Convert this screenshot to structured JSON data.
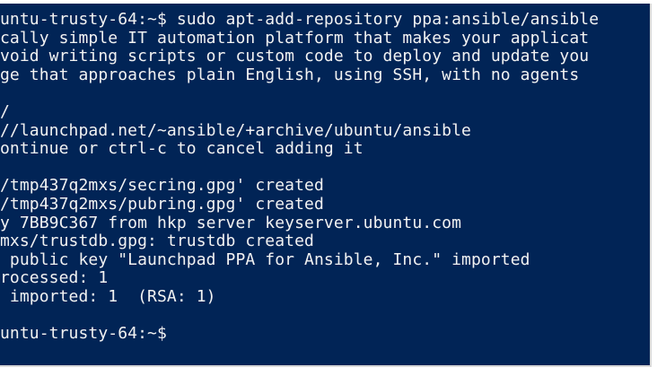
{
  "terminal": {
    "partial_top_line": "",
    "lines": [
      "untu-trusty-64:~$ sudo apt-add-repository ppa:ansible/ansible",
      "cally simple IT automation platform that makes your applicat",
      "void writing scripts or custom code to deploy and update you",
      "ge that approaches plain English, using SSH, with no agents",
      "",
      "/",
      "//launchpad.net/~ansible/+archive/ubuntu/ansible",
      "ontinue or ctrl-c to cancel adding it",
      "",
      "/tmp437q2mxs/secring.gpg' created",
      "/tmp437q2mxs/pubring.gpg' created",
      "y 7BB9C367 from hkp server keyserver.ubuntu.com",
      "mxs/trustdb.gpg: trustdb created",
      " public key \"Launchpad PPA for Ansible, Inc.\" imported",
      "rocessed: 1",
      " imported: 1  (RSA: 1)",
      "",
      "untu-trusty-64:~$"
    ]
  }
}
